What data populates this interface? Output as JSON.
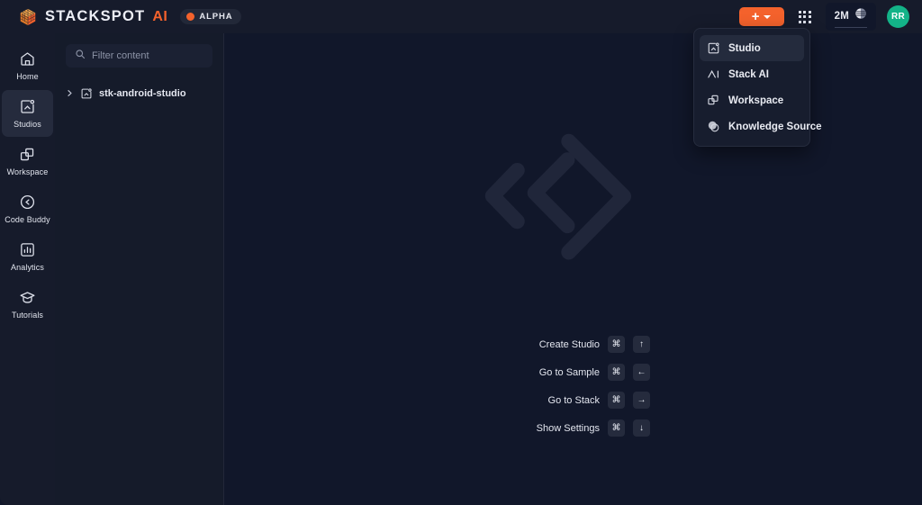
{
  "brand": {
    "logo_icon": "stackspot-cube-icon",
    "wordmark": "STACKSPOT",
    "ai_mark": "AI",
    "badge_label": "ALPHA",
    "accent_color": "#f4622c"
  },
  "topbar": {
    "create_button": {
      "icon": "plus-icon",
      "caret": "chevron-down-icon"
    },
    "apps_icon": "apps-grid-icon",
    "credits": {
      "value": "2M",
      "icon": "credits-coin-icon"
    },
    "avatar": {
      "initials": "RR",
      "color": "#13b388"
    }
  },
  "dropdown": {
    "items": [
      {
        "label": "Studio",
        "icon": "studio-icon",
        "active": true
      },
      {
        "label": "Stack AI",
        "icon": "stack-ai-icon",
        "active": false
      },
      {
        "label": "Workspace",
        "icon": "workspace-icon",
        "active": false
      },
      {
        "label": "Knowledge Source",
        "icon": "knowledge-source-icon",
        "active": false
      }
    ]
  },
  "sidebar": {
    "items": [
      {
        "label": "Home",
        "icon": "home-icon",
        "active": false
      },
      {
        "label": "Studios",
        "icon": "studios-icon",
        "active": true
      },
      {
        "label": "Workspace",
        "icon": "workspace-icon",
        "active": false
      },
      {
        "label": "Code Buddy",
        "icon": "code-buddy-icon",
        "active": false
      },
      {
        "label": "Analytics",
        "icon": "analytics-icon",
        "active": false
      },
      {
        "label": "Tutorials",
        "icon": "tutorials-icon",
        "active": false
      }
    ]
  },
  "filepanel": {
    "search": {
      "placeholder": "Filter content",
      "value": "",
      "icon": "search-icon"
    },
    "tree": [
      {
        "label": "stk-android-studio",
        "icon": "studio-icon",
        "chevron": "chevron-right-icon"
      }
    ]
  },
  "main": {
    "watermark_icon": "code-brackets-diamond-icon",
    "shortcuts": [
      {
        "label": "Create Studio",
        "key1": "⌘",
        "key2": "↑"
      },
      {
        "label": "Go to Sample",
        "key1": "⌘",
        "key2": "←"
      },
      {
        "label": "Go to Stack",
        "key1": "⌘",
        "key2": "→"
      },
      {
        "label": "Show Settings",
        "key1": "⌘",
        "key2": "↓"
      }
    ]
  }
}
